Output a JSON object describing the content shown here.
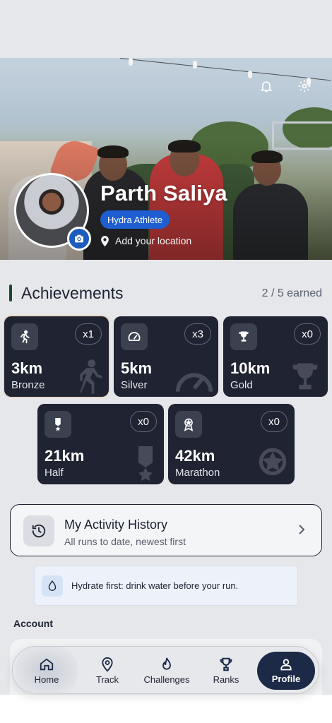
{
  "header": {
    "profile_name": "Parth Saliya",
    "role_badge": "Hydra Athlete",
    "location_prompt": "Add your location"
  },
  "achievements": {
    "title": "Achievements",
    "earned_summary": "2 / 5 earned",
    "items": [
      {
        "distance": "3km",
        "tier": "Bronze",
        "multiplier": "x1",
        "icon": "runner-icon",
        "earned": true
      },
      {
        "distance": "5km",
        "tier": "Silver",
        "multiplier": "x3",
        "icon": "speedometer-icon",
        "earned": true
      },
      {
        "distance": "10km",
        "tier": "Gold",
        "multiplier": "x0",
        "icon": "trophy-icon",
        "earned": false
      },
      {
        "distance": "21km",
        "tier": "Half",
        "multiplier": "x0",
        "icon": "medal-ribbon-icon",
        "earned": false
      },
      {
        "distance": "42km",
        "tier": "Marathon",
        "multiplier": "x0",
        "icon": "award-badge-icon",
        "earned": false
      }
    ]
  },
  "activity_history": {
    "title": "My Activity History",
    "subtitle": "All runs to date, newest first"
  },
  "tip": {
    "text": "Hydrate first: drink water before your run."
  },
  "account": {
    "label": "Account"
  },
  "nav": {
    "items": [
      {
        "label": "Home",
        "icon": "home-icon"
      },
      {
        "label": "Track",
        "icon": "map-pin-icon"
      },
      {
        "label": "Challenges",
        "icon": "flame-icon"
      },
      {
        "label": "Ranks",
        "icon": "trophy-icon"
      },
      {
        "label": "Profile",
        "icon": "user-icon"
      }
    ],
    "active": "Profile"
  },
  "colors": {
    "card_bg": "#1f2332",
    "accent_blue": "#1e5ed0",
    "nav_active": "#1c2a47",
    "page_bg": "#e6e7ea"
  }
}
